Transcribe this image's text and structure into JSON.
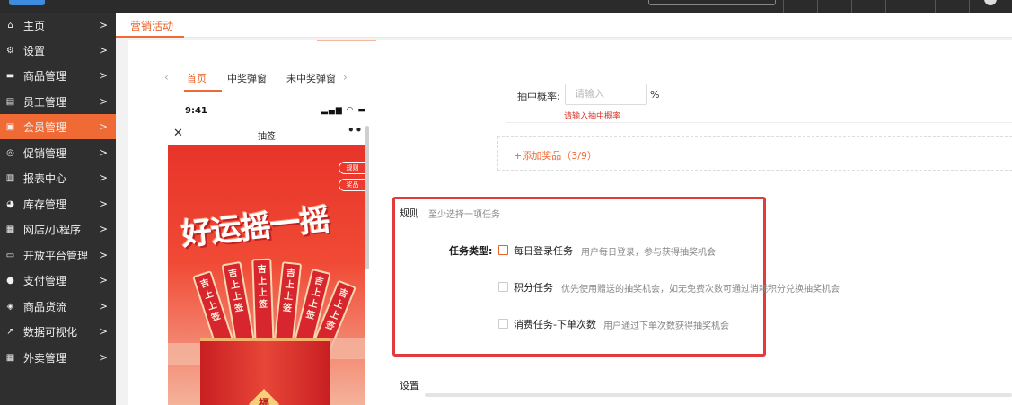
{
  "sidebar": {
    "items": [
      {
        "label": "主页",
        "icon": "home-icon",
        "active": false
      },
      {
        "label": "设置",
        "icon": "gear-icon",
        "active": false
      },
      {
        "label": "商品管理",
        "icon": "box-icon",
        "active": false
      },
      {
        "label": "员工管理",
        "icon": "id-card-icon",
        "active": false
      },
      {
        "label": "会员管理",
        "icon": "member-icon",
        "active": true
      },
      {
        "label": "促销管理",
        "icon": "check-circle-icon",
        "active": false
      },
      {
        "label": "报表中心",
        "icon": "bar-chart-icon",
        "active": false
      },
      {
        "label": "库存管理",
        "icon": "pie-icon",
        "active": false
      },
      {
        "label": "网店/小程序",
        "icon": "store-icon",
        "active": false
      },
      {
        "label": "开放平台管理",
        "icon": "monitor-icon",
        "active": false
      },
      {
        "label": "支付管理",
        "icon": "coin-icon",
        "active": false
      },
      {
        "label": "商品货流",
        "icon": "flow-icon",
        "active": false
      },
      {
        "label": "数据可视化",
        "icon": "line-chart-icon",
        "active": false
      },
      {
        "label": "外卖管理",
        "icon": "delivery-icon",
        "active": false
      }
    ]
  },
  "header": {
    "tab": "营销活动"
  },
  "preview": {
    "tabs": [
      "首页",
      "中奖弹窗",
      "未中奖弹窗"
    ],
    "active_tab": 0,
    "status_time": "9:41",
    "title": "抽签",
    "rules_pill": "规则",
    "prize_pill": "奖品",
    "headline": "好运摇一摇",
    "sticks": [
      "吉上上签",
      "吉上上签",
      "吉上上签",
      "吉上上签",
      "吉上上签",
      "吉上上签"
    ],
    "bucket_char": "福"
  },
  "prize": {
    "prob_label": "抽中概率:",
    "prob_placeholder": "请输入",
    "prob_unit": "%",
    "prob_error": "请输入抽中概率",
    "add_label": "+添加奖品（3/9）"
  },
  "rules": {
    "title": "规则",
    "hint": "至少选择一项任务",
    "task_type_label": "任务类型:",
    "tasks": [
      {
        "name": "每日登录任务",
        "desc": "用户每日登录，参与获得抽奖机会",
        "checked": false
      },
      {
        "name": "积分任务",
        "desc": "优先使用赠送的抽奖机会，如无免费次数可通过消耗积分兑换抽奖机会",
        "checked": false
      },
      {
        "name": "消费任务-下单次数",
        "desc": "用户通过下单次数获得抽奖机会",
        "checked": false
      }
    ]
  },
  "settings_title": "设置",
  "colors": {
    "accent": "#f06a35",
    "highlight": "#e23b3b",
    "sidebar": "#2f2f2f"
  }
}
